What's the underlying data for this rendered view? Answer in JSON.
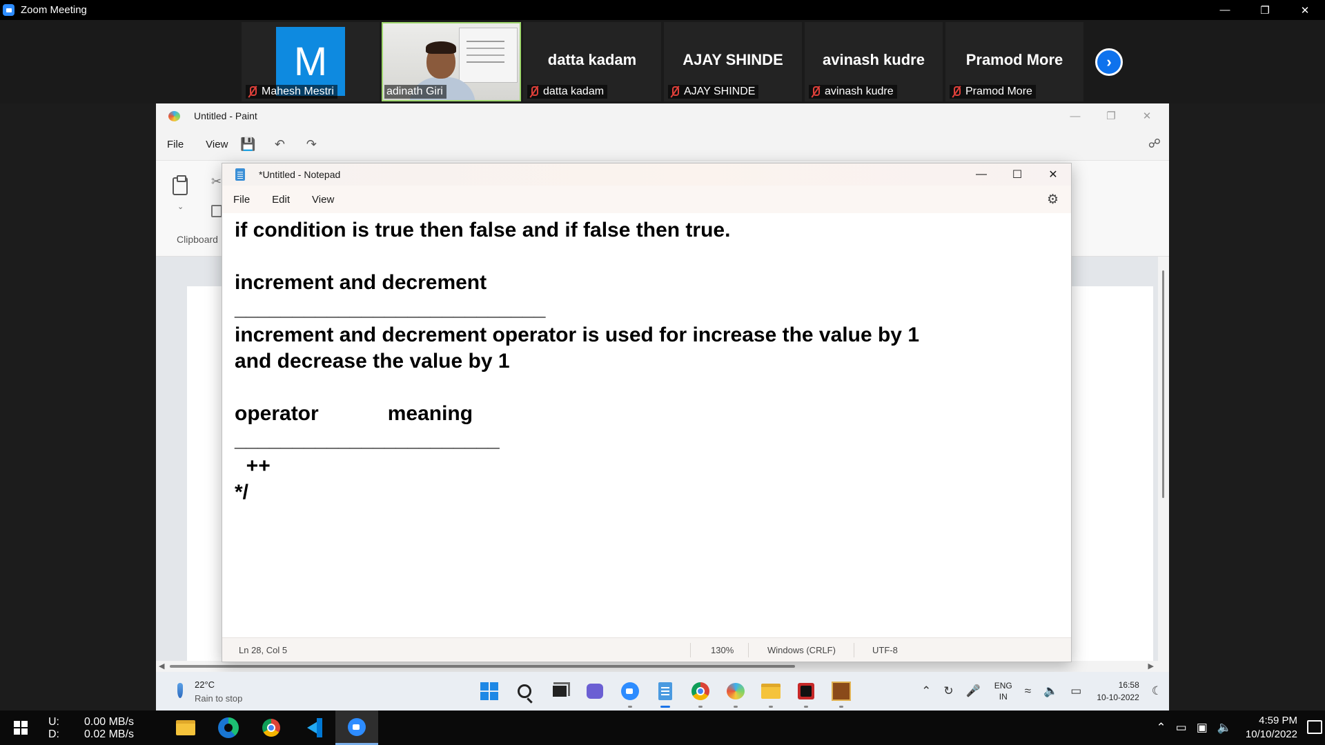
{
  "zoom": {
    "title": "Zoom Meeting",
    "window_controls": [
      "—",
      "❐",
      "✕"
    ]
  },
  "gallery": {
    "next_icon": "chevron-right-icon",
    "participants": [
      {
        "avatar_letter": "M",
        "label": "Mahesh Mestri",
        "muted": true,
        "type": "avatar",
        "avatar_color": "#0e8ae0"
      },
      {
        "label": "adinath Giri",
        "muted": false,
        "type": "video"
      },
      {
        "display_name": "datta kadam",
        "label": "datta kadam",
        "muted": true,
        "type": "name"
      },
      {
        "display_name": "AJAY SHINDE",
        "label": "AJAY SHINDE",
        "muted": true,
        "type": "name"
      },
      {
        "display_name": "avinash kudre",
        "label": "avinash kudre",
        "muted": true,
        "type": "name"
      },
      {
        "display_name": "Pramod More",
        "label": "Pramod More",
        "muted": true,
        "type": "name"
      }
    ]
  },
  "paint": {
    "title": "Untitled - Paint",
    "menu": [
      "File",
      "View"
    ],
    "clipboard_label": "Clipboard",
    "window_controls": [
      "—",
      "❐",
      "✕"
    ]
  },
  "notepad": {
    "title": "*Untitled - Notepad",
    "menu": [
      "File",
      "Edit",
      "View"
    ],
    "window_controls": [
      "—",
      "☐",
      "✕"
    ],
    "lines": [
      "if condition is true then false and if false then true.",
      "",
      "increment and decrement",
      "___________________________",
      "increment and decrement operator is used for increase the value by 1",
      "and decrease the value by 1",
      "",
      "operator            meaning",
      "_______________________",
      "  ++",
      "*/"
    ],
    "status": {
      "position": "Ln 28, Col 5",
      "zoom": "130%",
      "line_ending": "Windows (CRLF)",
      "encoding": "UTF-8"
    }
  },
  "inner_taskbar": {
    "weather_temp": "22°C",
    "weather_desc": "Rain to stop",
    "lang_top": "ENG",
    "lang_bottom": "IN",
    "time": "16:58",
    "date": "10-10-2022"
  },
  "outer_taskbar": {
    "net_labels": [
      "U:",
      "D:"
    ],
    "net_values": [
      "0.00 MB/s",
      "0.02 MB/s"
    ],
    "time": "4:59 PM",
    "date": "10/10/2022"
  },
  "colors": {
    "zoom_blue": "#2d8cff",
    "muted_red": "#e0403a",
    "active_speaker": "#9fd76d"
  }
}
